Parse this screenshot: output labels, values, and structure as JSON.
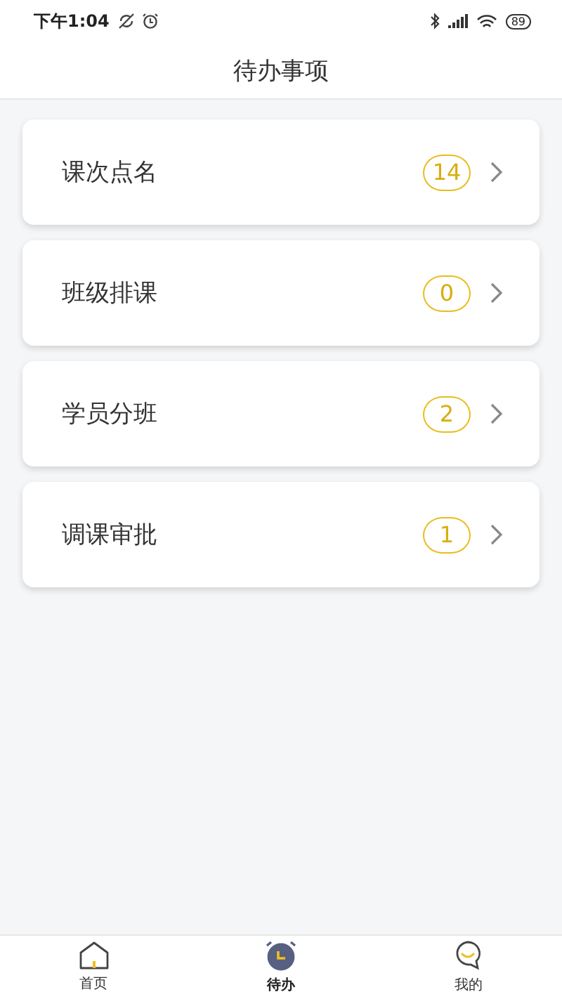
{
  "status_bar": {
    "time": "下午1:04",
    "battery": "89"
  },
  "header": {
    "title": "待办事项"
  },
  "items": [
    {
      "label": "课次点名",
      "count": "14"
    },
    {
      "label": "班级排课",
      "count": "0"
    },
    {
      "label": "学员分班",
      "count": "2"
    },
    {
      "label": "调课审批",
      "count": "1"
    }
  ],
  "tabs": [
    {
      "label": "首页",
      "kind": "home",
      "selected": false
    },
    {
      "label": "待办",
      "kind": "todo",
      "selected": true
    },
    {
      "label": "我的",
      "kind": "me",
      "selected": false
    }
  ]
}
